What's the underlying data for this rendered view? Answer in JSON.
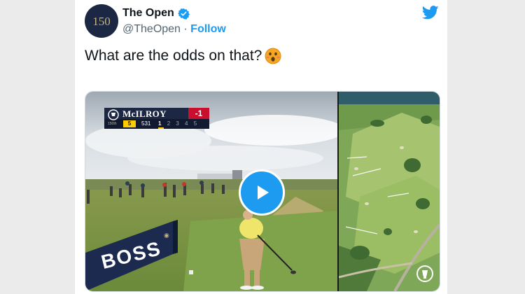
{
  "account": {
    "display_name": "The Open",
    "handle": "@TheOpen",
    "separator": " · ",
    "follow_label": "Follow",
    "avatar_text": "150"
  },
  "tweet": {
    "text": "What are the odds on that?"
  },
  "scoreboard": {
    "player": "McILROY",
    "score": "-1",
    "par": "5",
    "yards": "531",
    "current_shot": "1",
    "other_shots": "2 3 4 5",
    "badge": "150th"
  },
  "sponsor": {
    "text": "BOSS"
  },
  "colors": {
    "accent": "#1d9bf0",
    "navy": "#1c2743",
    "score_red": "#c8102e",
    "par_yellow": "#ffcc00"
  },
  "icons": {
    "verified": "verified-badge-icon",
    "twitter": "twitter-bird-icon",
    "play": "play-icon",
    "emoji": "astonished-face-emoji"
  }
}
